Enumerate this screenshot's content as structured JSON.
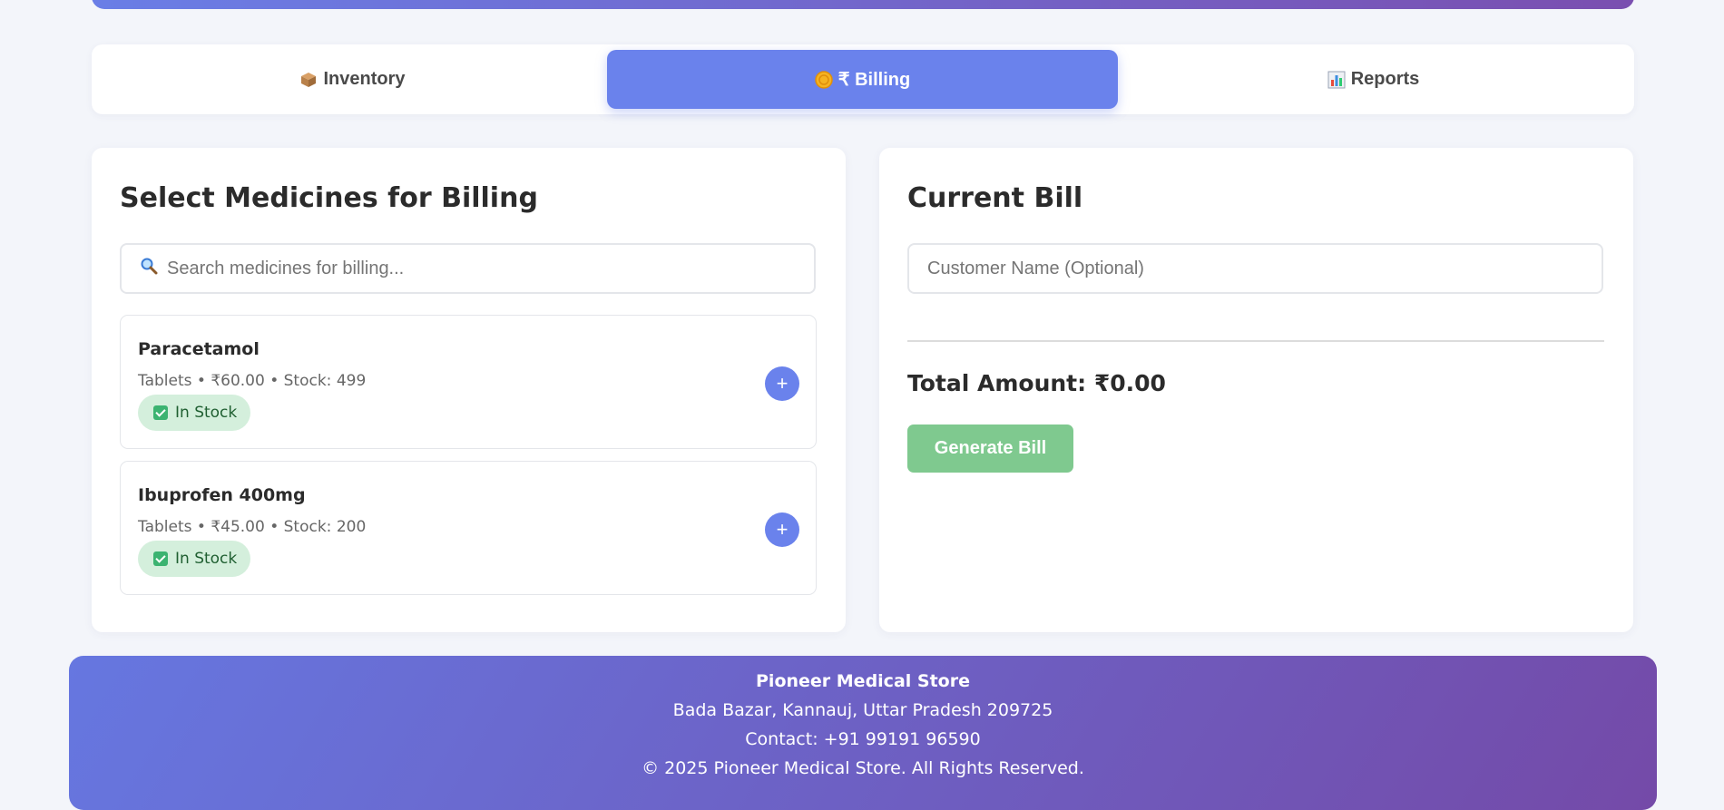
{
  "tabs": [
    {
      "label": "Inventory",
      "icon": "package-icon"
    },
    {
      "label": "₹ Billing",
      "icon": "coin-icon"
    },
    {
      "label": "Reports",
      "icon": "bar-chart-icon"
    }
  ],
  "left_panel": {
    "title": "Select Medicines for Billing",
    "search_placeholder": "Search medicines for billing...",
    "medicines": [
      {
        "name": "Paracetamol",
        "meta": "Tablets • ₹60.00 • Stock: 499",
        "badge": "In Stock",
        "add_label": "+"
      },
      {
        "name": "Ibuprofen 400mg",
        "meta": "Tablets • ₹45.00 • Stock: 200",
        "badge": "In Stock",
        "add_label": "+"
      }
    ]
  },
  "right_panel": {
    "title": "Current Bill",
    "customer_placeholder": "Customer Name (Optional)",
    "total": "Total Amount: ₹0.00",
    "generate_label": "Generate Bill"
  },
  "footer": {
    "store_name": "Pioneer Medical Store",
    "address": "Bada Bazar, Kannauj, Uttar Pradesh 209725",
    "contact": "Contact: +91 99191 96590",
    "copyright": "© 2025 Pioneer Medical Store. All Rights Reserved."
  },
  "colors": {
    "accent": "#6a82ec",
    "success": "#7fc98f",
    "badge_bg": "#d4efdc",
    "footer_start": "#6677e0",
    "footer_end": "#744aa8"
  }
}
